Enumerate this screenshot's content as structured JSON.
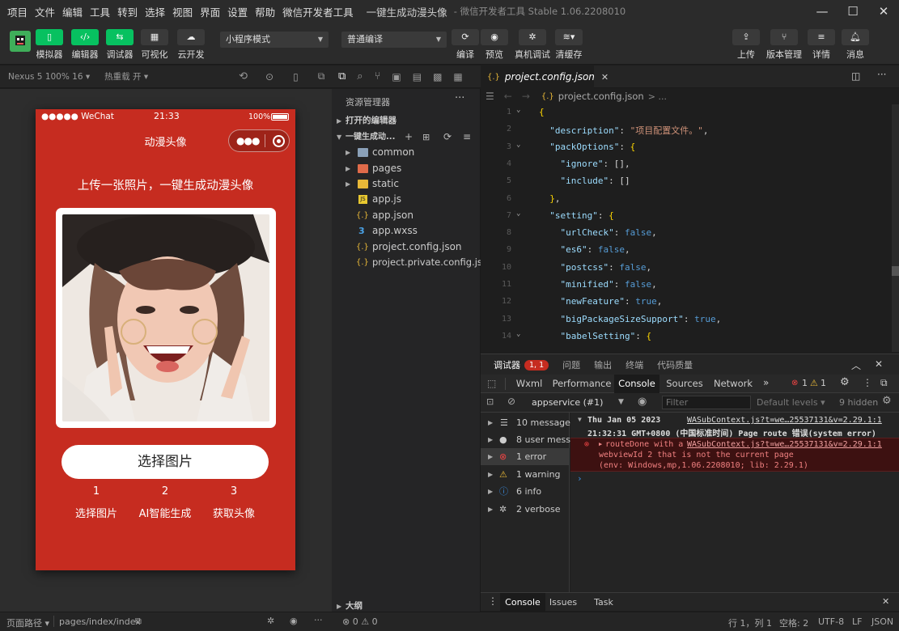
{
  "menubar": {
    "items": [
      "项目",
      "文件",
      "编辑",
      "工具",
      "转到",
      "选择",
      "视图",
      "界面",
      "设置",
      "帮助",
      "微信开发者工具"
    ],
    "title": "一键生成动漫头像",
    "subtitle": "- 微信开发者工具 Stable 1.06.2208010"
  },
  "toolbar": {
    "left": [
      "模拟器",
      "编辑器",
      "调试器",
      "可视化",
      "云开发"
    ],
    "mode_select": "小程序模式",
    "compile_select": "普通编译",
    "middle": [
      "编译",
      "预览",
      "真机调试",
      "清缓存"
    ],
    "right": [
      "上传",
      "版本管理",
      "详情",
      "消息"
    ]
  },
  "simulator": {
    "device": "Nexus 5 100% 16",
    "hotreload": "热重载 开",
    "status_carrier": "●●●●● WeChat",
    "status_time": "21:33",
    "status_battery": "100%",
    "nav_title": "动漫头像",
    "headline": "上传一张照片，一键生成动漫头像",
    "choose_button": "选择图片",
    "steps": [
      {
        "num": "1",
        "label": "选择图片"
      },
      {
        "num": "2",
        "label": "AI智能生成"
      },
      {
        "num": "3",
        "label": "获取头像"
      }
    ]
  },
  "explorer": {
    "title": "资源管理器",
    "open_editors": "打开的编辑器",
    "project": "一键生成动...",
    "folders": [
      "common",
      "pages",
      "static"
    ],
    "files": [
      "app.js",
      "app.json",
      "app.wxss",
      "project.config.json",
      "project.private.config.json"
    ],
    "outline": "大纲"
  },
  "editor": {
    "tab": "project.config.json",
    "breadcrumb": "project.config.json",
    "breadcrumb_more": "> ...",
    "lines": [
      {
        "n": "1",
        "html": "<span class='p'>{</span>"
      },
      {
        "n": "2",
        "html": "  <span class='k'>\"description\"</span>: <span class='s'>\"项目配置文件。\"</span>,"
      },
      {
        "n": "3",
        "html": "  <span class='k'>\"packOptions\"</span>: <span class='p'>{</span>"
      },
      {
        "n": "4",
        "html": "    <span class='k'>\"ignore\"</span>: [],"
      },
      {
        "n": "5",
        "html": "    <span class='k'>\"include\"</span>: []"
      },
      {
        "n": "6",
        "html": "  <span class='p'>}</span>,"
      },
      {
        "n": "7",
        "html": "  <span class='k'>\"setting\"</span>: <span class='p'>{</span>"
      },
      {
        "n": "8",
        "html": "    <span class='k'>\"urlCheck\"</span>: <span class='b'>false</span>,"
      },
      {
        "n": "9",
        "html": "    <span class='k'>\"es6\"</span>: <span class='b'>false</span>,"
      },
      {
        "n": "10",
        "html": "    <span class='k'>\"postcss\"</span>: <span class='b'>false</span>,"
      },
      {
        "n": "11",
        "html": "    <span class='k'>\"minified\"</span>: <span class='b'>false</span>,"
      },
      {
        "n": "12",
        "html": "    <span class='k'>\"newFeature\"</span>: <span class='b'>true</span>,"
      },
      {
        "n": "13",
        "html": "    <span class='k'>\"bigPackageSizeSupport\"</span>: <span class='b'>true</span>,"
      },
      {
        "n": "14",
        "html": "    <span class='k'>\"babelSetting\"</span>: <span class='p'>{</span>"
      }
    ]
  },
  "devtools": {
    "head_tabs": [
      "调试器",
      "问题",
      "输出",
      "终端",
      "代码质量"
    ],
    "badge": "1, 1",
    "tabs": [
      "Wxml",
      "Performance",
      "Console",
      "Sources",
      "Network"
    ],
    "error_count": "1",
    "warn_count": "1",
    "context": "appservice (#1)",
    "filter_placeholder": "Filter",
    "levels": "Default levels",
    "hidden": "9 hidden",
    "side": [
      {
        "label": "10 messages",
        "icon": "list"
      },
      {
        "label": "8 user mess...",
        "icon": "user"
      },
      {
        "label": "1 error",
        "icon": "error"
      },
      {
        "label": "1 warning",
        "icon": "warning"
      },
      {
        "label": "6 info",
        "icon": "info"
      },
      {
        "label": "2 verbose",
        "icon": "verbose"
      }
    ],
    "msg1_time": "Thu Jan 05 2023",
    "msg1_time2": "21:32:31 GMT+0800 (中国标准时间) Page route 错误(system error)",
    "msg1_link": "WASubContext.js?t=we…25537131&v=2.29.1:1",
    "msg2_text": "routeDone with a",
    "msg2_link": "WASubContext.js?t=we…25537131&v=2.29.1:1",
    "msg2_line2": "webviewId 2 that is not the current page",
    "msg2_line3": "(env: Windows,mp,1.06.2208010; lib: 2.29.1)",
    "drawer_tabs": [
      "Console",
      "Issues",
      "Task"
    ]
  },
  "statusbar": {
    "page_path_label": "页面路径",
    "page_path": "pages/index/index",
    "errors": "0",
    "warnings": "0",
    "position": "行 1，列 1",
    "spaces": "空格: 2",
    "encoding": "UTF-8",
    "eol": "LF",
    "lang": "JSON"
  }
}
